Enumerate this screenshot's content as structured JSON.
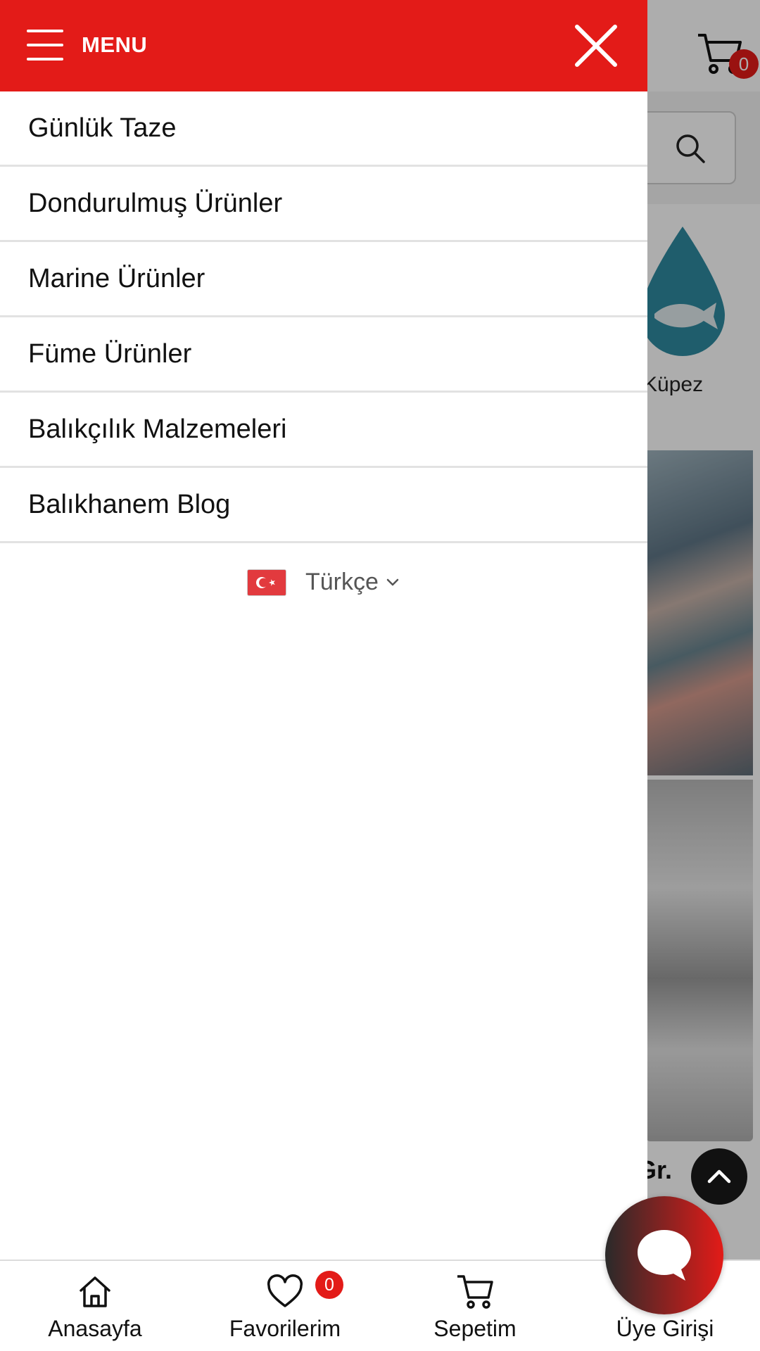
{
  "background_page": {
    "cart_count": "0",
    "category_label": "Küpez",
    "price_fragment": "Gr."
  },
  "drawer": {
    "menu_title": "MENU",
    "items": [
      {
        "label": "Günlük Taze"
      },
      {
        "label": "Dondurulmuş Ürünler"
      },
      {
        "label": "Marine Ürünler"
      },
      {
        "label": "Füme Ürünler"
      },
      {
        "label": "Balıkçılık Malzemeleri"
      },
      {
        "label": "Balıkhanem Blog"
      }
    ],
    "language": {
      "label": "Türkçe",
      "flag_icon": "turkey-flag-icon"
    }
  },
  "tabbar": {
    "tabs": [
      {
        "label": "Anasayfa",
        "icon": "home-icon"
      },
      {
        "label": "Favorilerim",
        "icon": "heart-icon",
        "badge": "0"
      },
      {
        "label": "Sepetim",
        "icon": "cart-icon"
      },
      {
        "label": "Üye Girişi",
        "icon": "user-icon"
      }
    ]
  },
  "colors": {
    "brand_red": "#e31b18",
    "divider": "#e2e2e2",
    "overlay": "rgba(0,0,0,0.32)"
  }
}
